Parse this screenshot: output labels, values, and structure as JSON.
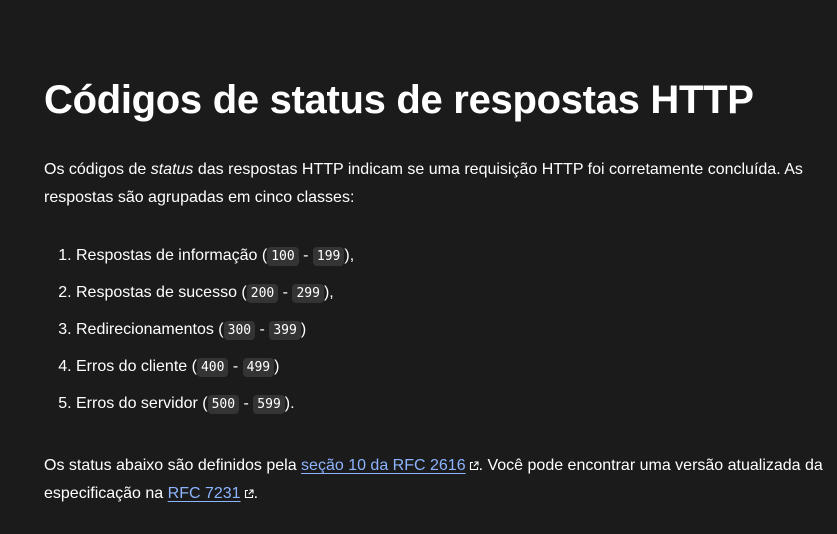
{
  "heading": "Códigos de status de respostas HTTP",
  "intro": {
    "before": "Os códigos de ",
    "emphasis": "status",
    "after": " das respostas HTTP indicam se uma requisição HTTP foi corretamente concluída. As respostas são agrupadas em cinco classes:"
  },
  "classes": [
    {
      "label": "Respostas de informação (",
      "start": "100",
      "sep": " - ",
      "end": "199",
      "suffix": "),"
    },
    {
      "label": "Respostas de sucesso (",
      "start": "200",
      "sep": " - ",
      "end": "299",
      "suffix": "),"
    },
    {
      "label": "Redirecionamentos (",
      "start": "300",
      "sep": " - ",
      "end": "399",
      "suffix": ")"
    },
    {
      "label": "Erros do cliente (",
      "start": "400",
      "sep": " - ",
      "end": "499",
      "suffix": ")"
    },
    {
      "label": "Erros do servidor (",
      "start": "500",
      "sep": " - ",
      "end": "599",
      "suffix": ")."
    }
  ],
  "outro": {
    "before": "Os status abaixo são definidos pela ",
    "link1_text": "seção 10 da RFC 2616",
    "middle": ". Você pode encontrar uma versão atualizada da especificação na ",
    "link2_text": "RFC 7231",
    "after": "."
  },
  "colors": {
    "background": "#1b1b1b",
    "text": "#ffffff",
    "link": "#8cb4ff",
    "code_background": "#343434"
  },
  "icons": {
    "external_link": "external-link-icon"
  }
}
